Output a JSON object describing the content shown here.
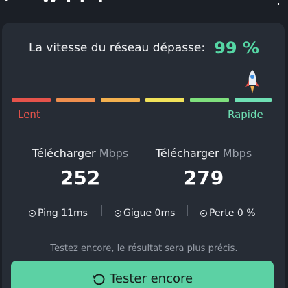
{
  "topbar": {
    "title": "W I F I",
    "back_icon": "arrow-left-icon",
    "menu_icon": "more-vertical-icon"
  },
  "result": {
    "headline": "La vitesse du réseau dépasse:",
    "percent": "99 %",
    "level_fraction": 0.99
  },
  "scale": {
    "low_label": "Lent",
    "high_label": "Rapide",
    "segment_colors": [
      "#e5534b",
      "#ef8f4e",
      "#f3b14f",
      "#f1e25a",
      "#7fe07d",
      "#6fe0b4"
    ]
  },
  "stats": {
    "download": {
      "label": "Télécharger",
      "unit": "Mbps",
      "value": "252"
    },
    "upload": {
      "label": "Télécharger",
      "unit": "Mbps",
      "value": "279"
    }
  },
  "metrics": {
    "ping": "Ping 11ms",
    "jitter": "Gigue 0ms",
    "loss": "Perte 0 %"
  },
  "hint": "Testez encore, le résultat sera plus précis.",
  "retry_button": "Tester encore",
  "colors": {
    "accent": "#5cd1a4",
    "background": "#1b1f26",
    "card": "#262c35"
  }
}
